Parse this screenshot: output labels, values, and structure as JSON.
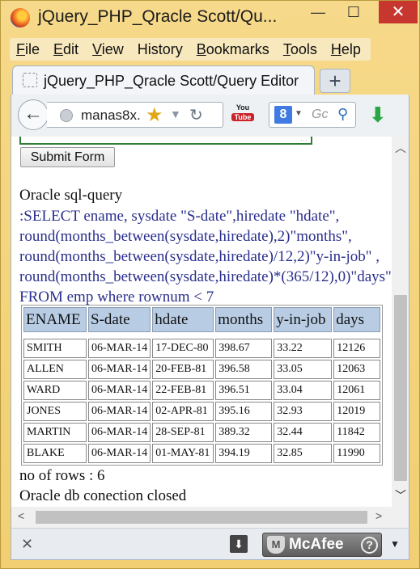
{
  "window": {
    "title": "jQuery_PHP_Qracle Scott/Qu...",
    "minimize": "—",
    "maximize": "☐",
    "close": "✕"
  },
  "menu": {
    "items": [
      {
        "label": "File",
        "accel": "F",
        "rest": "ile"
      },
      {
        "label": "Edit",
        "accel": "E",
        "rest": "dit"
      },
      {
        "label": "View",
        "accel": "V",
        "rest": "iew"
      },
      {
        "label": "History",
        "accel": "",
        "rest": "History"
      },
      {
        "label": "Bookmarks",
        "accel": "B",
        "rest": "ookmarks"
      },
      {
        "label": "Tools",
        "accel": "T",
        "rest": "ools"
      },
      {
        "label": "Help",
        "accel": "H",
        "rest": "elp"
      }
    ]
  },
  "tab": {
    "label": "jQuery_PHP_Qracle Scott/Query Editor",
    "new_tab": "+"
  },
  "navbar": {
    "back": "←",
    "url": "manas8x.",
    "search_engine": "8",
    "search_placeholder": "Gc",
    "youtube_label": "You",
    "youtube_tube": "Tube"
  },
  "page": {
    "submit_label": "Submit Form",
    "query_heading": "Oracle sql-query",
    "query_text": ":SELECT ename, sysdate \"S-date\",hiredate \"hdate\", round(months_between(sysdate,hiredate),2)\"months\", round(months_between(sysdate,hiredate)/12,2)\"y-in-job\" , round(months_between(sysdate,hiredate)*(365/12),0)\"days\" FROM emp where rownum < 7",
    "rows_count": "no of rows : 6",
    "closed_msg": "Oracle db conection closed"
  },
  "table": {
    "columns": [
      "ENAME",
      "S-date",
      "hdate",
      "months",
      "y-in-job",
      "days"
    ],
    "rows": [
      [
        "SMITH",
        "06-MAR-14",
        "17-DEC-80",
        "398.67",
        "33.22",
        "12126"
      ],
      [
        "ALLEN",
        "06-MAR-14",
        "20-FEB-81",
        "396.58",
        "33.05",
        "12063"
      ],
      [
        "WARD",
        "06-MAR-14",
        "22-FEB-81",
        "396.51",
        "33.04",
        "12061"
      ],
      [
        "JONES",
        "06-MAR-14",
        "02-APR-81",
        "395.16",
        "32.93",
        "12019"
      ],
      [
        "MARTIN",
        "06-MAR-14",
        "28-SEP-81",
        "389.32",
        "32.44",
        "11842"
      ],
      [
        "BLAKE",
        "06-MAR-14",
        "01-MAY-81",
        "394.19",
        "32.85",
        "11990"
      ]
    ]
  },
  "addon_bar": {
    "close": "✕",
    "mcafee_label": "McAfee",
    "help": "?"
  },
  "colors": {
    "frame": "#f1cf72",
    "query_text": "#2a2f8d",
    "table_header": "#b8cce4",
    "close_button": "#c7372f"
  }
}
